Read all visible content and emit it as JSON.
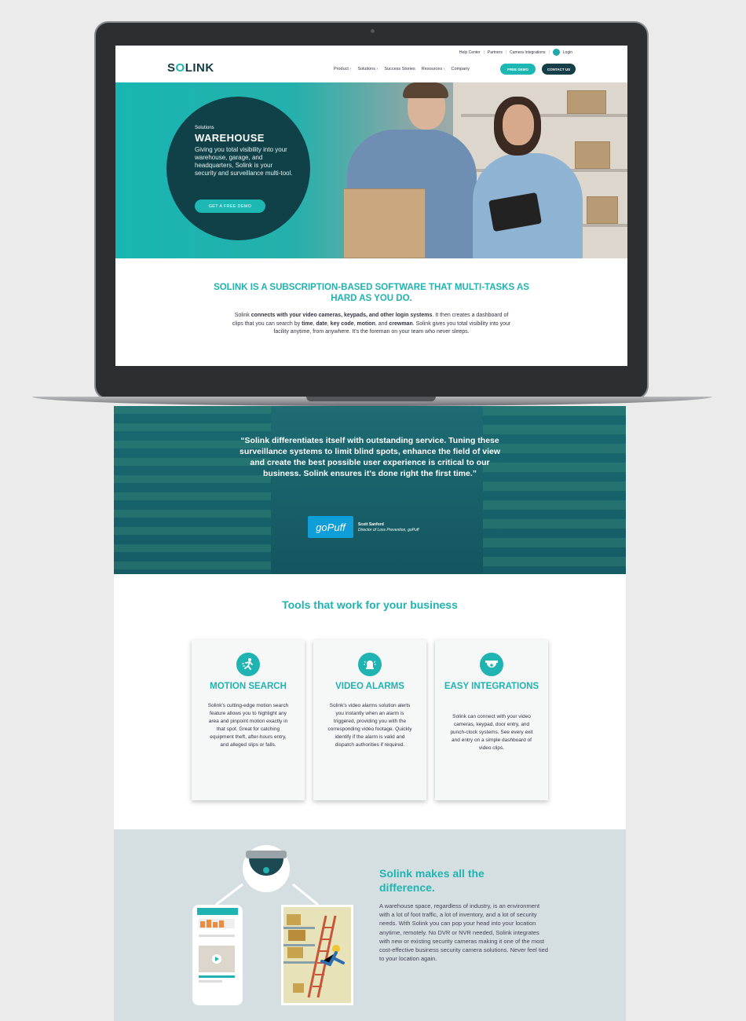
{
  "screen": {
    "topbar": {
      "help": "Help Center",
      "partners": "Partners",
      "camera": "Camera Integrations",
      "login": "Login"
    },
    "logo": {
      "prefix": "S",
      "accent": "O",
      "suffix": "LINK"
    },
    "nav": [
      "Product",
      "Solutions",
      "Success Stories",
      "Resources",
      "Company"
    ],
    "free_demo": "FREE DEMO",
    "contact": "CONTACT US",
    "hero": {
      "kicker": "Solutions",
      "title": "WAREHOUSE",
      "text": "Giving you total visibility into your warehouse, garage, and headquarters, Solink is your security and surveillance multi-tool.",
      "button": "GET A FREE DEMO"
    },
    "heading": "SOLINK IS A SUBSCRIPTION-BASED SOFTWARE THAT MULTI-TASKS AS HARD AS YOU DO.",
    "body": {
      "p1": "Solink ",
      "b1": "connects with your video cameras, keypads, and other login systems",
      "p2": ". It then creates a dashboard of clips that you can search by ",
      "b2": "time",
      "c1": ", ",
      "b3": "date",
      "c2": ", ",
      "b4": "key code",
      "c3": ", ",
      "b5": "motion",
      "p3": ", and ",
      "b6": "crewman",
      "p4": ". Solink gives you total visibility into your facility anytime, from anywhere. It's the foreman on your team who never sleeps."
    }
  },
  "quote": {
    "text": "“Solink differentiates itself with outstanding service. Tuning these surveillance systems to limit blind spots, enhance the field of view and create the best possible user experience is critical to our business. Solink ensures it's done right the first time.”",
    "brand": "goPuff",
    "author_name": "Scott Sanford",
    "author_role": "Director of Loss Prevention, goPuff"
  },
  "tools": {
    "title": "Tools that work for your business",
    "cards": [
      {
        "icon": "running-person-icon",
        "title": "MOTION SEARCH",
        "text": "Solink's cutting-edge motion search feature allows you to highlight any area and pinpoint motion exactly in that spot. Great for catching equipment theft, after-hours entry, and alleged slips or falls."
      },
      {
        "icon": "alarm-bell-icon",
        "title": "VIDEO ALARMS",
        "text": "Solink's video alarms solution alerts you instantly when an alarm is triggered, providing you with the corresponding video footage. Quickly identify if the alarm is valid and dispatch authorities if required."
      },
      {
        "icon": "dome-camera-icon",
        "title": "EASY INTEGRATIONS",
        "text": "Solink can connect with your video cameras, keypad, door entry, and punch-clock systems. See every exit and entry on a simple dashboard of video clips."
      }
    ]
  },
  "difference": {
    "title": "Solink makes all the difference.",
    "text": "A warehouse space, regardless of industry, is an environment with a lot of foot traffic, a lot of inventory, and a lot of security needs. With Solink you can pop your head into your location anytime, remotely. No DVR or NVR needed, Solink integrates with new or existing security cameras making it one of the most cost-effective business security camera solutions. Never feel tied to your location again."
  },
  "colors": {
    "teal": "#1fb3b1",
    "dark": "#104148",
    "navy": "#163e48"
  }
}
